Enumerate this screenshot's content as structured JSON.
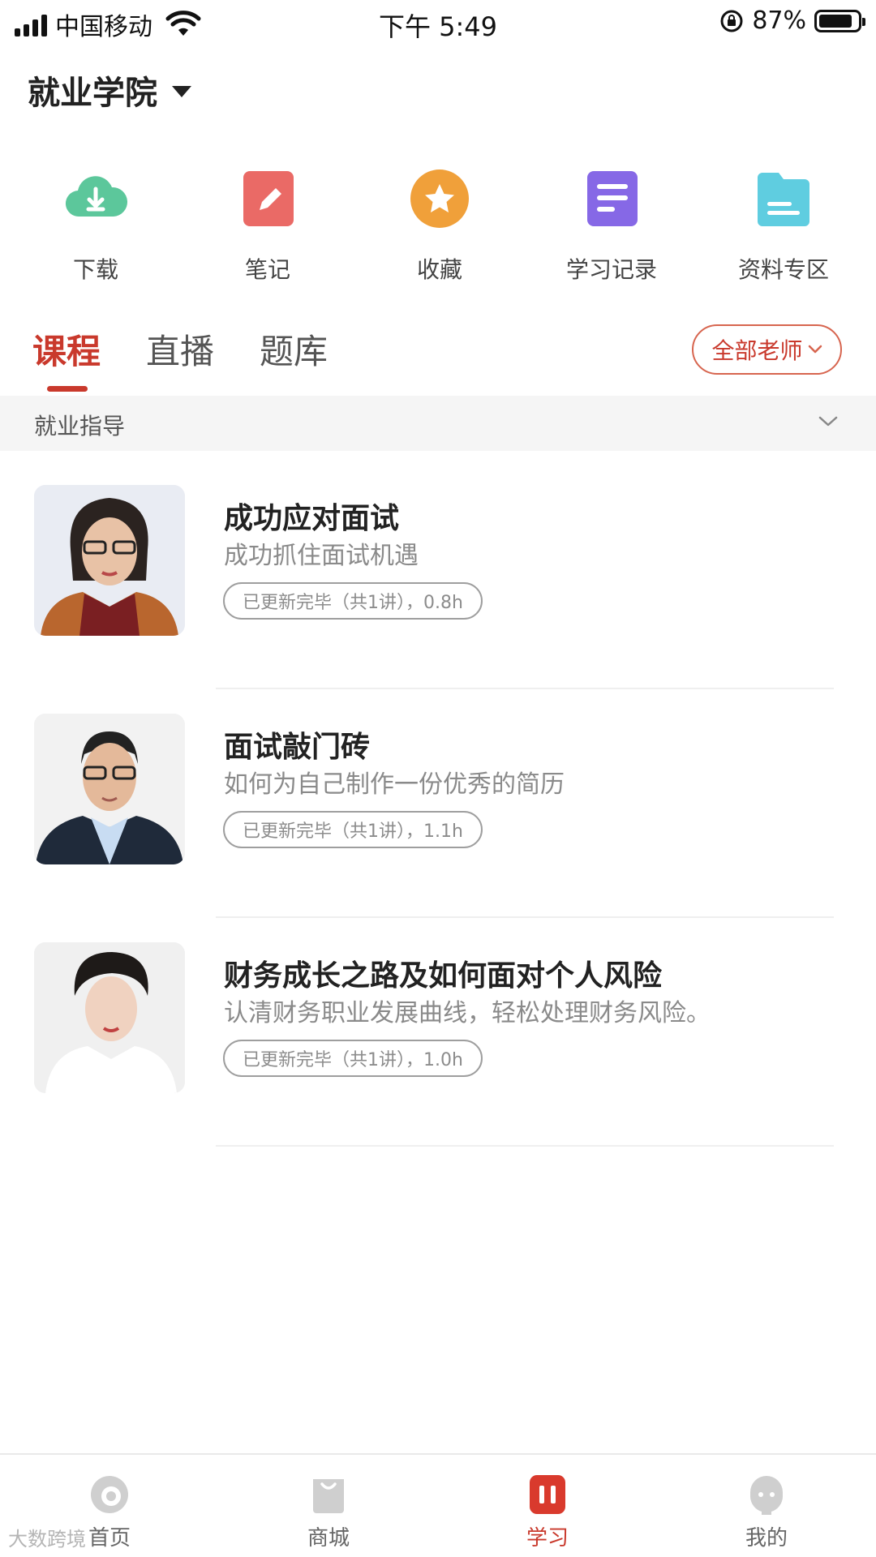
{
  "status_bar": {
    "carrier": "中国移动",
    "time": "下午 5:49",
    "battery": "87%",
    "battery_level": 0.87
  },
  "header": {
    "title": "就业学院"
  },
  "quick_actions": [
    {
      "label": "下载",
      "icon": "download-cloud-icon",
      "color": "#5cc79b"
    },
    {
      "label": "笔记",
      "icon": "pencil-note-icon",
      "color": "#ea6a66"
    },
    {
      "label": "收藏",
      "icon": "star-favorite-icon",
      "color": "#f0a03a"
    },
    {
      "label": "学习记录",
      "icon": "study-record-icon",
      "color": "#8668e6"
    },
    {
      "label": "资料专区",
      "icon": "folder-materials-icon",
      "color": "#5fcde0"
    }
  ],
  "tabs": [
    {
      "label": "课程",
      "active": true
    },
    {
      "label": "直播",
      "active": false
    },
    {
      "label": "题库",
      "active": false
    }
  ],
  "teacher_filter": {
    "label": "全部老师"
  },
  "category": {
    "label": "就业指导"
  },
  "courses": [
    {
      "title": "成功应对面试",
      "subtitle": "成功抓住面试机遇",
      "badge": "已更新完毕（共1讲），0.8h"
    },
    {
      "title": "面试敲门砖",
      "subtitle": "如何为自己制作一份优秀的简历",
      "badge": "已更新完毕（共1讲），1.1h"
    },
    {
      "title": "财务成长之路及如何面对个人风险",
      "subtitle": "认清财务职业发展曲线，轻松处理财务风险。",
      "badge": "已更新完毕（共1讲），1.0h"
    }
  ],
  "bottom_nav": [
    {
      "label": "首页",
      "active": false
    },
    {
      "label": "商城",
      "active": false
    },
    {
      "label": "学习",
      "active": true
    },
    {
      "label": "我的",
      "active": false
    }
  ],
  "watermark": "大数跨境",
  "colors": {
    "accent": "#c9392c",
    "text": "#222222",
    "muted": "#8a8a8a"
  }
}
